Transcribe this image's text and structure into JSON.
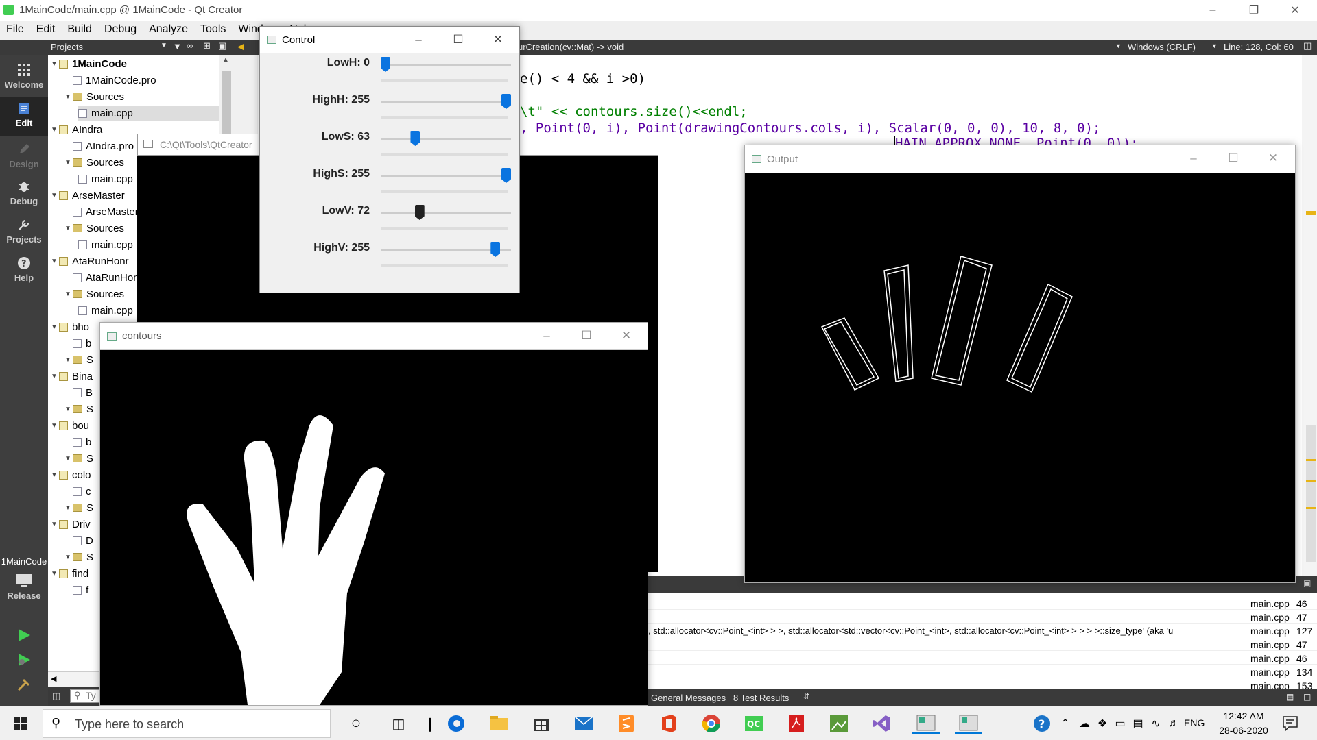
{
  "app": {
    "title": "1MainCode/main.cpp @ 1MainCode - Qt Creator"
  },
  "menu": [
    "File",
    "Edit",
    "Build",
    "Debug",
    "Analyze",
    "Tools",
    "Window",
    "Help"
  ],
  "toolbar": {
    "panel": "Projects",
    "function": "urCreation(cv::Mat) -> void",
    "line_ending": "Windows (CRLF)",
    "position": "Line: 128, Col: 60"
  },
  "modes": [
    "Welcome",
    "Edit",
    "Design",
    "Debug",
    "Projects",
    "Help"
  ],
  "kit": {
    "project": "1MainCode",
    "build": "Release"
  },
  "tree": [
    {
      "label": "1MainCode",
      "kind": "project",
      "bold": true
    },
    {
      "label": "1MainCode.pro",
      "kind": "file"
    },
    {
      "label": "Sources",
      "kind": "folder"
    },
    {
      "label": "main.cpp",
      "kind": "file",
      "selected": true
    },
    {
      "label": "AIndra",
      "kind": "project"
    },
    {
      "label": "AIndra.pro",
      "kind": "file"
    },
    {
      "label": "Sources",
      "kind": "folder"
    },
    {
      "label": "main.cpp",
      "kind": "file"
    },
    {
      "label": "ArseMaster",
      "kind": "project"
    },
    {
      "label": "ArseMaster.pro",
      "kind": "file"
    },
    {
      "label": "Sources",
      "kind": "folder"
    },
    {
      "label": "main.cpp",
      "kind": "file"
    },
    {
      "label": "AtaRunHonr",
      "kind": "project"
    },
    {
      "label": "AtaRunHonr.pro",
      "kind": "file"
    },
    {
      "label": "Sources",
      "kind": "folder"
    },
    {
      "label": "main.cpp",
      "kind": "file"
    },
    {
      "label": "bho",
      "kind": "project"
    },
    {
      "label": "b",
      "kind": "file"
    },
    {
      "label": "S",
      "kind": "folder"
    },
    {
      "label": "Bina",
      "kind": "project"
    },
    {
      "label": "B",
      "kind": "file"
    },
    {
      "label": "S",
      "kind": "folder"
    },
    {
      "label": "bou",
      "kind": "project"
    },
    {
      "label": "b",
      "kind": "file"
    },
    {
      "label": "S",
      "kind": "folder"
    },
    {
      "label": "colo",
      "kind": "project"
    },
    {
      "label": "c",
      "kind": "file"
    },
    {
      "label": "S",
      "kind": "folder"
    },
    {
      "label": "Driv",
      "kind": "project"
    },
    {
      "label": "D",
      "kind": "file"
    },
    {
      "label": "S",
      "kind": "folder"
    },
    {
      "label": "find",
      "kind": "project"
    },
    {
      "label": "f",
      "kind": "file"
    }
  ],
  "code": [
    "e() < 4 && i >0)",
    "",
    "\\t\" << contours.size()<<endl;",
    ", Point(0, i), Point(drawingContours.cols, i), Scalar(0, 0, 0), 10, 8, 0);",
    "HAIN_APPROX_NONE, Point(0, 0));"
  ],
  "console_title": "C:\\Qt\\Tools\\QtCreator",
  "control": {
    "title": "Control",
    "sliders": [
      {
        "label": "LowH: 0",
        "value": 0,
        "max": 179
      },
      {
        "label": "HighH: 255",
        "value": 255,
        "max": 255
      },
      {
        "label": "LowS: 63",
        "value": 63,
        "max": 255
      },
      {
        "label": "HighS: 255",
        "value": 255,
        "max": 255
      },
      {
        "label": "LowV: 72",
        "value": 72,
        "max": 255
      },
      {
        "label": "HighV: 255",
        "value": 255,
        "max": 280
      }
    ]
  },
  "contours_title": "contours",
  "output_title": "Output",
  "issues": [
    {
      "text": "",
      "file": "main.cpp",
      "line": "46"
    },
    {
      "text": "",
      "file": "main.cpp",
      "line": "47"
    },
    {
      "text": ", std::allocator<cv::Point_<int> > >, std::allocator<std::vector<cv::Point_<int>, std::allocator<cv::Point_<int> > > > >::size_type' (aka 'u",
      "file": "main.cpp",
      "line": "127"
    },
    {
      "text": "",
      "file": "main.cpp",
      "line": "47"
    },
    {
      "text": "",
      "file": "main.cpp",
      "line": "46"
    },
    {
      "text": "",
      "file": "main.cpp",
      "line": "134"
    },
    {
      "text": "",
      "file": "main.cpp",
      "line": "153"
    }
  ],
  "output_tabs": [
    "General Messages",
    "8 Test Results"
  ],
  "taskbar": {
    "search": "Type here to search",
    "lang": "ENG",
    "time": "12:42 AM",
    "date": "28-06-2020"
  },
  "search_filter": "Ty"
}
